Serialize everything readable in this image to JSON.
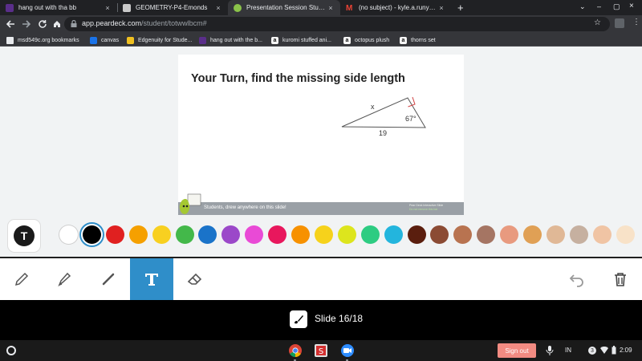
{
  "tabs": [
    {
      "title": "hang out with tha bb",
      "close": "×",
      "favicon_color": "#5a2e8a"
    },
    {
      "title": "GEOMETRY-P4-Emonds",
      "close": "×",
      "favicon_color": "#c9c9c9"
    },
    {
      "title": "Presentation Session Student",
      "close": "×",
      "favicon_color": "#8bc34a"
    },
    {
      "title": "(no subject) - kyle.a.runyan@ms...",
      "close": "×",
      "favicon_color": "#ea4335"
    }
  ],
  "new_tab": "+",
  "window_controls": [
    "⌄",
    "–",
    "▢",
    "×"
  ],
  "address": {
    "domain": "app.peardeck.com",
    "path": "/student/totwwlbcm#"
  },
  "bookmarks": [
    {
      "label": "msd549c.org bookmarks",
      "color": "#e0a000"
    },
    {
      "label": "canvas",
      "color": "#1a73e8"
    },
    {
      "label": "Edgenuity for Stude...",
      "color": "#f0c020"
    },
    {
      "label": "hang out with the b...",
      "color": "#5a2e8a"
    },
    {
      "label": "kuromi stuffed ani...",
      "color": "#f4f4f4"
    },
    {
      "label": "octopus plush",
      "color": "#f4f4f4"
    },
    {
      "label": "thorns set",
      "color": "#f4f4f4"
    }
  ],
  "slide": {
    "title": "Your Turn, find the missing side length",
    "side_hyp": "x",
    "angle": "67°",
    "side_base": "19",
    "footer_text": "Students, drew anywhere on this slide!",
    "footer_right_1": "Pear Deck Interactive Slide",
    "footer_right_2": "Do not remove this bar"
  },
  "palette": [
    "#ffffff",
    "#000000",
    "#e02020",
    "#f5a000",
    "#f8d020",
    "#43b84a",
    "#1a73c9",
    "#9b48c9",
    "#e94ad6",
    "#e8175d",
    "#f79100",
    "#f6d21b",
    "#dde51d",
    "#2dcc82",
    "#23b5dd",
    "#5a1e0e",
    "#8b4b34",
    "#b87350",
    "#a57563",
    "#e89a7f",
    "#e0a055",
    "#e0b896",
    "#c6b0a0",
    "#f0c4a4",
    "#f8e2c8"
  ],
  "tools": [
    "pencil",
    "marker",
    "pen",
    "text",
    "eraser"
  ],
  "slidebar": {
    "label": "Slide 16/18"
  },
  "shelf": {
    "signout": "Sign out",
    "ime": "IN",
    "notifications": "3",
    "time": "2:09"
  }
}
